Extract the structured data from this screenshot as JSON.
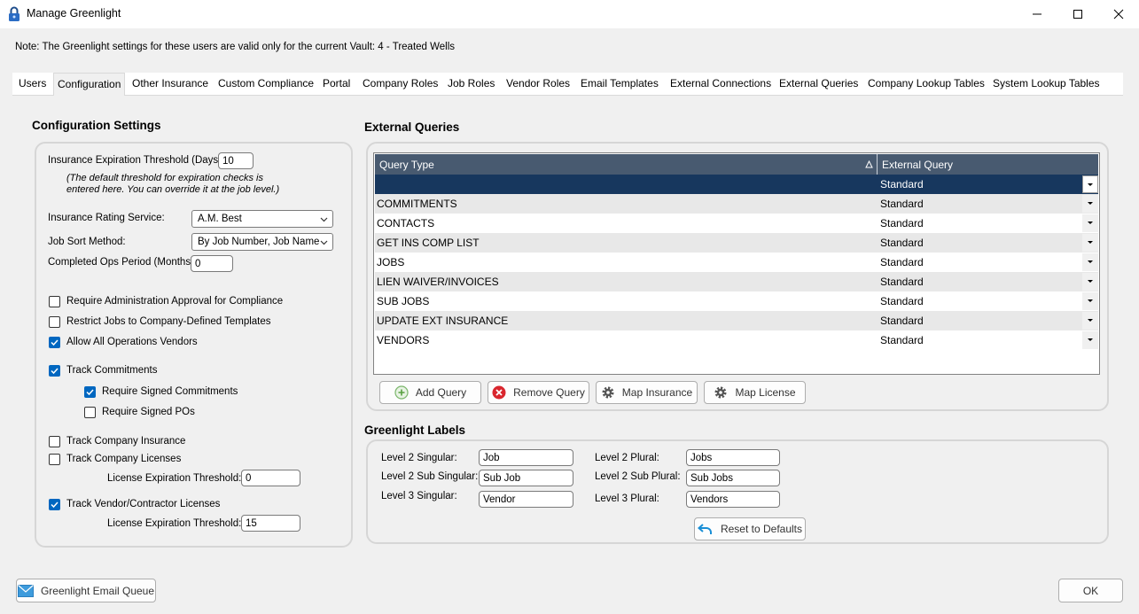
{
  "window": {
    "title": "Manage Greenlight",
    "minimize": "—",
    "maximize": "☐",
    "close": "✕"
  },
  "note": "Note:  The Greenlight settings for these users are valid only for the current Vault: 4 - Treated Wells",
  "tabs": [
    {
      "label": "Users"
    },
    {
      "label": "Configuration"
    },
    {
      "label": "Other Insurance"
    },
    {
      "label": "Custom Compliance"
    },
    {
      "label": "Portal"
    },
    {
      "label": "Company Roles"
    },
    {
      "label": "Job Roles"
    },
    {
      "label": "Vendor Roles"
    },
    {
      "label": "Email Templates"
    },
    {
      "label": "External Connections"
    },
    {
      "label": "External Queries"
    },
    {
      "label": "Company Lookup Tables"
    },
    {
      "label": "System Lookup Tables"
    }
  ],
  "config": {
    "title": "Configuration Settings",
    "threshold_label": "Insurance Expiration Threshold (Days):",
    "threshold_value": "10",
    "threshold_note_1": "(The default threshold for expiration checks is",
    "threshold_note_2": "entered here. You can override it at the job level.)",
    "rating_label": "Insurance Rating Service:",
    "rating_value": "A.M. Best",
    "sort_label": "Job Sort Method:",
    "sort_value": "By Job Number, Job Name",
    "ops_label": "Completed Ops Period (Months):",
    "ops_value": "0",
    "chk_admin_approval": "Require Administration Approval for Compliance",
    "chk_restrict_jobs": "Restrict Jobs to Company-Defined Templates",
    "chk_allow_all_ops": "Allow All Operations Vendors",
    "chk_track_commitments": "Track Commitments",
    "chk_signed_commitments": "Require Signed Commitments",
    "chk_signed_pos": "Require Signed POs",
    "chk_company_insurance": "Track Company Insurance",
    "chk_company_licenses": "Track Company Licenses",
    "company_license_threshold_label": "License Expiration Threshold:",
    "company_license_threshold_value": "0",
    "chk_vendor_licenses": "Track Vendor/Contractor Licenses",
    "vendor_license_threshold_label": "License Expiration Threshold:",
    "vendor_license_threshold_value": "15"
  },
  "external_queries": {
    "title": "External Queries",
    "col_query_type": "Query Type",
    "col_external_query": "External Query",
    "rows": [
      {
        "type": "",
        "ext": "Standard"
      },
      {
        "type": "COMMITMENTS",
        "ext": "Standard"
      },
      {
        "type": "CONTACTS",
        "ext": "Standard"
      },
      {
        "type": "GET INS COMP LIST",
        "ext": "Standard"
      },
      {
        "type": "JOBS",
        "ext": "Standard"
      },
      {
        "type": "LIEN WAIVER/INVOICES",
        "ext": "Standard"
      },
      {
        "type": "SUB JOBS",
        "ext": "Standard"
      },
      {
        "type": "UPDATE EXT INSURANCE",
        "ext": "Standard"
      },
      {
        "type": "VENDORS",
        "ext": "Standard"
      }
    ],
    "add_label": "Add Query",
    "remove_label": "Remove Query",
    "map_insurance_label": "Map Insurance",
    "map_license_label": "Map License"
  },
  "labels": {
    "title": "Greenlight Labels",
    "l2_singular_label": "Level 2 Singular:",
    "l2_singular_value": "Job",
    "l2_sub_singular_label": "Level 2 Sub Singular:",
    "l2_sub_singular_value": "Sub Job",
    "l3_singular_label": "Level 3 Singular:",
    "l3_singular_value": "Vendor",
    "l2_plural_label": "Level 2 Plural:",
    "l2_plural_value": "Jobs",
    "l2_sub_plural_label": "Level 2 Sub Plural:",
    "l2_sub_plural_value": "Sub Jobs",
    "l3_plural_label": "Level 3 Plural:",
    "l3_plural_value": "Vendors",
    "reset_label": "Reset to Defaults"
  },
  "footer": {
    "email_queue_label": "Greenlight Email Queue",
    "ok_label": "OK"
  },
  "colors": {
    "accent": "#0067c0",
    "grid_header": "#485a70",
    "grid_selected": "#17375e"
  }
}
